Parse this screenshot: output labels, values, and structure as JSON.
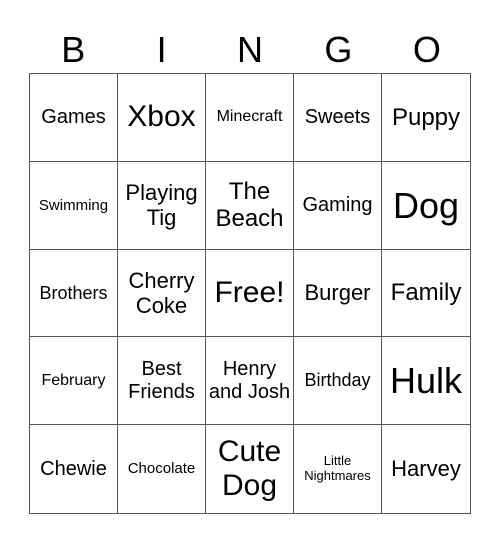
{
  "header": [
    "B",
    "I",
    "N",
    "G",
    "O"
  ],
  "cells": [
    [
      "Games",
      "Xbox",
      "Minecraft",
      "Sweets",
      "Puppy"
    ],
    [
      "Swimming",
      "Playing Tig",
      "The Beach",
      "Gaming",
      "Dog"
    ],
    [
      "Brothers",
      "Cherry Coke",
      "Free!",
      "Burger",
      "Family"
    ],
    [
      "February",
      "Best Friends",
      "Henry and Josh",
      "Birthday",
      "Hulk"
    ],
    [
      "Chewie",
      "Chocolate",
      "Cute Dog",
      "Little Nightmares",
      "Harvey"
    ]
  ]
}
